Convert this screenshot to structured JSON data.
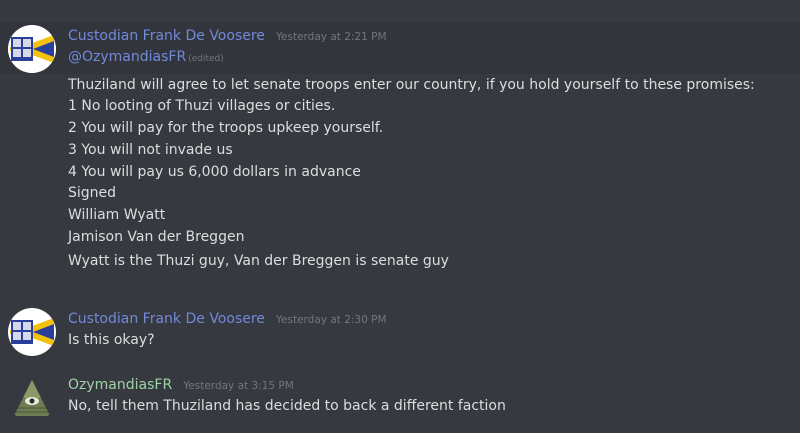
{
  "messages": [
    {
      "author": "Custodian Frank De Voosere",
      "timestamp": "Yesterday at 2:21 PM",
      "mention": "@OzymandiasFR",
      "edited": "(edited)",
      "lines": [
        "Thuziland will agree to let senate troops enter our country, if you hold yourself to these promises:",
        "1 No looting of Thuzi villages or cities.",
        "2 You will pay for the troops upkeep yourself.",
        "3 You will not invade us",
        "4 You will pay us 6,000 dollars in advance",
        "Signed",
        "William Wyatt",
        "Jamison Van der Breggen"
      ],
      "followup": "Wyatt is the Thuzi guy, Van der Breggen is senate guy"
    },
    {
      "author": "Custodian Frank De Voosere",
      "timestamp": "Yesterday at 2:30 PM",
      "text": "Is this okay?"
    },
    {
      "author": "OzymandiasFR",
      "timestamp": "Yesterday at 3:15 PM",
      "text": "No, tell them Thuziland has decided to back a different faction"
    }
  ],
  "colors": {
    "background": "#36393f",
    "highlight": "#32353b",
    "username_blurple": "#7289da",
    "username_green": "#9fd3a7",
    "text": "#dcddde",
    "muted": "#72767d"
  },
  "icons": {
    "avatar_frank": "flag-emblem-avatar",
    "avatar_ozy": "eye-pyramid-avatar"
  }
}
